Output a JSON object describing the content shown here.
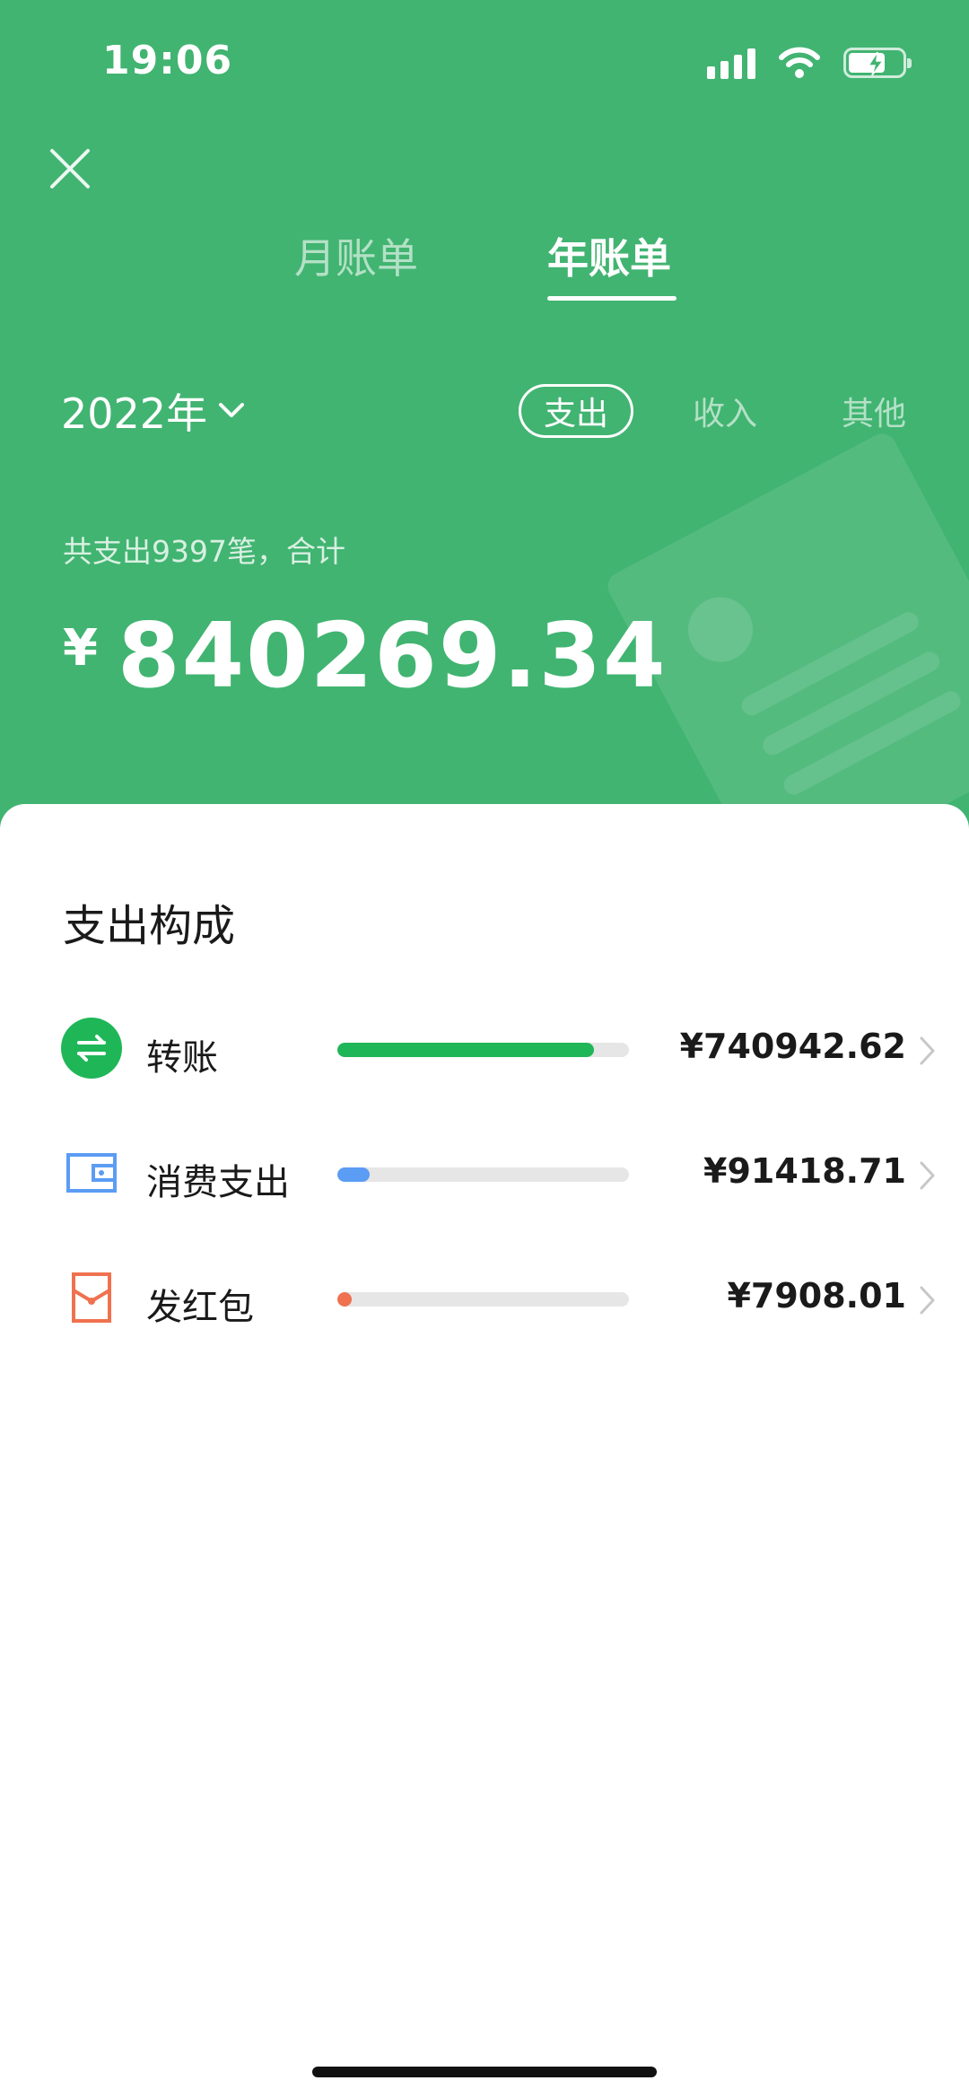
{
  "status_bar": {
    "time": "19:06"
  },
  "tabs": [
    {
      "label": "月账单",
      "active": false
    },
    {
      "label": "年账单",
      "active": true
    }
  ],
  "year_selector": {
    "label": "2022年"
  },
  "type_filters": [
    {
      "label": "支出",
      "active": true
    },
    {
      "label": "收入",
      "active": false
    },
    {
      "label": "其他",
      "active": false
    }
  ],
  "summary": {
    "caption": "共支出9397笔，合计",
    "currency": "¥",
    "total": "840269.34"
  },
  "composition": {
    "title": "支出构成",
    "items": [
      {
        "name": "转账",
        "amount": "¥740942.62",
        "share": 0.88,
        "color": "#1fb658",
        "icon": "transfer-icon"
      },
      {
        "name": "消费支出",
        "amount": "¥91418.71",
        "share": 0.11,
        "color": "#5b9cf4",
        "icon": "wallet-icon"
      },
      {
        "name": "发红包",
        "amount": "¥7908.01",
        "share": 0.01,
        "color": "#f0714f",
        "icon": "red-packet-icon"
      }
    ]
  },
  "colors": {
    "header_green": "#41b471",
    "transfer_green": "#1fb658",
    "wallet_blue": "#5b9cf4",
    "redpacket_orange": "#f0714f"
  }
}
